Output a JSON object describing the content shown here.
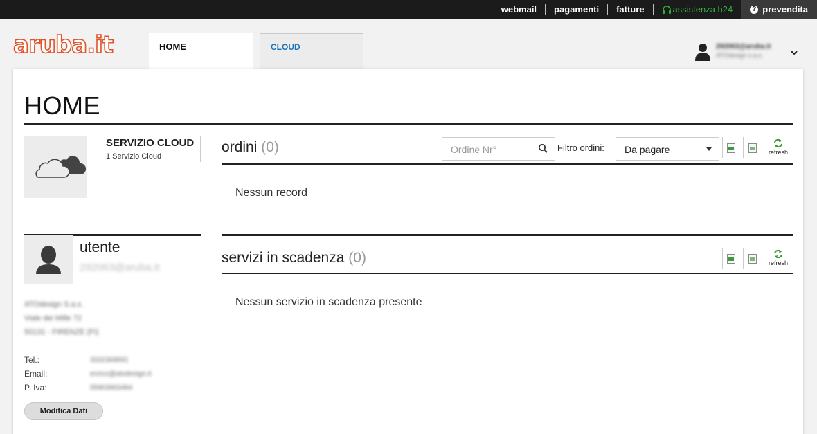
{
  "topbar": {
    "webmail": "webmail",
    "pagamenti": "pagamenti",
    "fatture": "fatture",
    "assistenza": "assistenza h24",
    "prevendita": "prevendita"
  },
  "header": {
    "logo": "aruba.it",
    "tabs": [
      {
        "label": "HOME"
      },
      {
        "label": "CLOUD"
      }
    ],
    "account": {
      "id": "292063@aruba.it",
      "company": "ATOdesign s.a.s."
    }
  },
  "main": {
    "title": "HOME",
    "service": {
      "title": "SERVIZIO CLOUD",
      "subtitle": "1 Servizio Cloud"
    },
    "orders": {
      "title": "ordini",
      "count": "(0)",
      "search_placeholder": "Ordine Nr°",
      "filter_label": "Filtro ordini:",
      "filter_value": "Da pagare",
      "refresh": "refresh",
      "empty": "Nessun record"
    },
    "expiring": {
      "title": "servizi in scadenza",
      "count": "(0)",
      "refresh": "refresh",
      "empty": "Nessun servizio in scadenza presente"
    },
    "user": {
      "heading": "utente",
      "id": "292063@aruba.it",
      "address": [
        "ATOdesign S.a.s.",
        "Viale dei Mille 72",
        "50131 - FIRENZE (FI)"
      ],
      "tel_label": "Tel.:",
      "tel_value": "3332369691",
      "email_label": "Email:",
      "email_value": "enrico@atodesign.it",
      "piva_label": "P. Iva:",
      "piva_value": "05903963484",
      "edit_button": "Modifica Dati"
    }
  },
  "colors": {
    "accent_orange": "#e0542a",
    "link_blue": "#1a72b8",
    "assist_green": "#2fb23a",
    "topbar": "#1b1b1b"
  }
}
